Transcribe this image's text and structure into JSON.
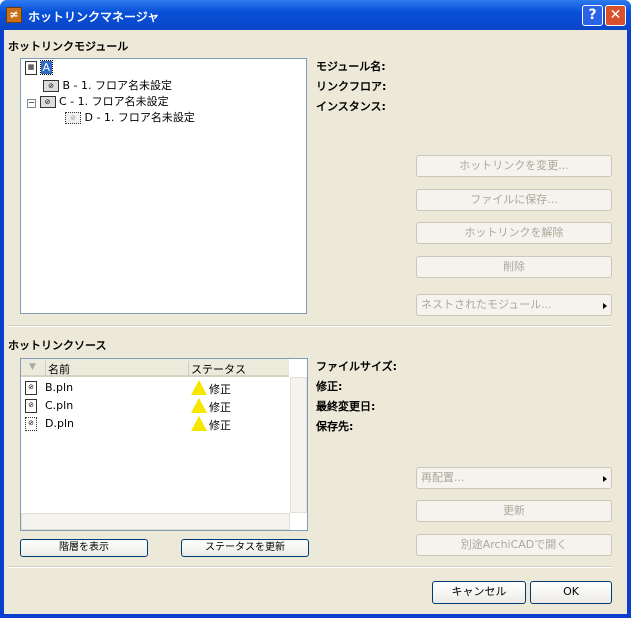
{
  "window": {
    "title": "ホットリンクマネージャ",
    "help": "?",
    "close": "✕"
  },
  "modules": {
    "heading": "ホットリンクモジュール",
    "tree": [
      {
        "label": "A"
      },
      {
        "label": "B - 1. フロア名未設定"
      },
      {
        "label": "C - 1. フロア名未設定"
      },
      {
        "label": "D - 1. フロア名未設定"
      }
    ],
    "info_labels": [
      "モジュール名:",
      "リンクフロア:",
      "インスタンス:"
    ],
    "buttons": [
      "ホットリンクを変更...",
      "ファイルに保存...",
      "ホットリンクを解除",
      "削除",
      "ネストされたモジュール..."
    ]
  },
  "sources": {
    "heading": "ホットリンクソース",
    "columns": [
      "名前",
      "ステータス"
    ],
    "rows": [
      {
        "name": "B.pln",
        "status": "修正"
      },
      {
        "name": "C.pln",
        "status": "修正"
      },
      {
        "name": "D.pln",
        "status": "修正"
      }
    ],
    "info_labels": [
      "ファイルサイズ:",
      "修正:",
      "最終変更日:",
      "保存先:"
    ],
    "buttons": [
      "再配置...",
      "更新",
      "別途ArchiCADで開く"
    ],
    "show_hierarchy": "階層を表示",
    "refresh_status": "ステータスを更新"
  },
  "footer": {
    "cancel": "キャンセル",
    "ok": "OK"
  }
}
